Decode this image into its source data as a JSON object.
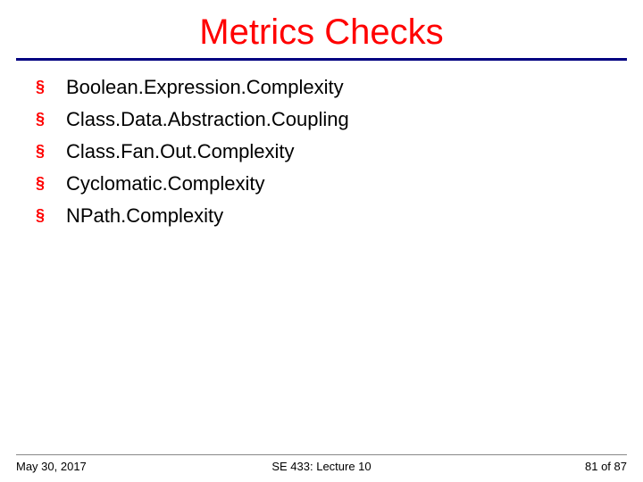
{
  "title": "Metrics Checks",
  "bullets": [
    "Boolean.Expression.Complexity",
    "Class.Data.Abstraction.Coupling",
    "Class.Fan.Out.Complexity",
    "Cyclomatic.Complexity",
    "NPath.Complexity"
  ],
  "footer": {
    "date": "May 30, 2017",
    "course": "SE 433: Lecture 10",
    "page": "81 of 87"
  }
}
